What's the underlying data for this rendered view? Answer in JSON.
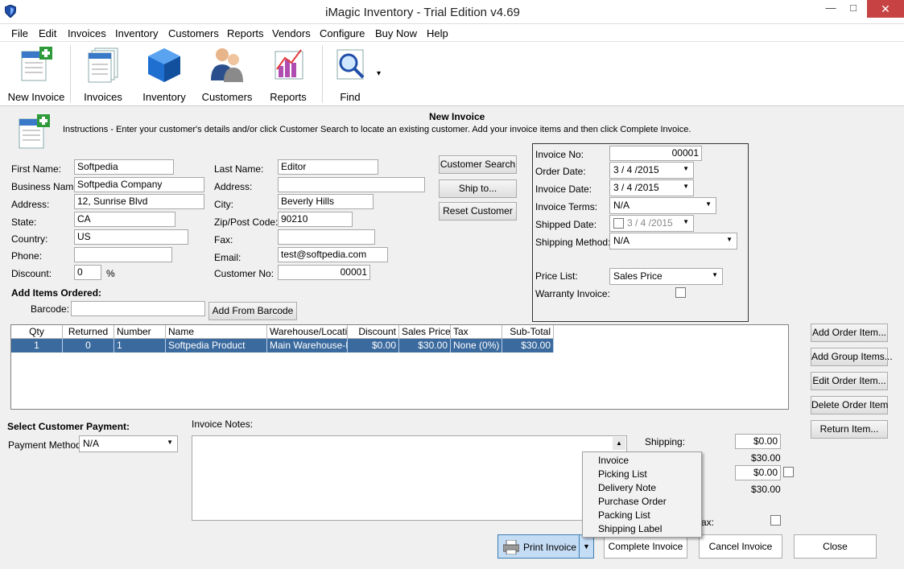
{
  "window": {
    "title": "iMagic Inventory - Trial Edition v4.69",
    "minimize": "—",
    "maximize": "□",
    "close": "✕"
  },
  "menu": [
    "File",
    "Edit",
    "Invoices",
    "Inventory",
    "Customers",
    "Reports",
    "Vendors",
    "Configure",
    "Buy Now",
    "Help"
  ],
  "toolbar": {
    "new_invoice": "New Invoice",
    "invoices": "Invoices",
    "inventory": "Inventory",
    "customers": "Customers",
    "reports": "Reports",
    "find": "Find",
    "find_dropdown": "▾"
  },
  "form": {
    "heading": "New Invoice",
    "instructions": "Instructions -  Enter your customer's details and/or click Customer Search to locate an existing customer. Add your invoice items and then click Complete Invoice.",
    "first_name_label": "First Name:",
    "first_name": "Softpedia",
    "business_name_label": "Business Name:",
    "business_name": "Softpedia Company",
    "address_label": "Address:",
    "address": "12, Sunrise Blvd",
    "state_label": "State:",
    "state": "CA",
    "country_label": "Country:",
    "country": "US",
    "phone_label": "Phone:",
    "phone": "",
    "discount_label": "Discount:",
    "discount": "0",
    "discount_unit": "%",
    "last_name_label": "Last Name:",
    "last_name": "Editor",
    "address2_label": "Address:",
    "address2": "",
    "city_label": "City:",
    "city": "Beverly Hills",
    "zip_label": "Zip/Post Code:",
    "zip": "90210",
    "fax_label": "Fax:",
    "fax": "",
    "email_label": "Email:",
    "email": "test@softpedia.com",
    "customer_no_label": "Customer No:",
    "customer_no": "00001",
    "customer_search": "Customer Search",
    "ship_to": "Ship to...",
    "reset_customer": "Reset Customer"
  },
  "invoice": {
    "invoice_no_label": "Invoice No:",
    "invoice_no": "00001",
    "order_date_label": "Order Date:",
    "order_date": "3 / 4 /2015",
    "invoice_date_label": "Invoice Date:",
    "invoice_date": "3 / 4 /2015",
    "terms_label": "Invoice Terms:",
    "terms": "N/A",
    "shipped_date_label": "Shipped Date:",
    "shipped_date": "3 / 4 /2015",
    "shipping_method_label": "Shipping Method:",
    "shipping_method": "N/A",
    "price_list_label": "Price List:",
    "price_list": "Sales Price",
    "warranty_label": "Warranty Invoice:"
  },
  "items": {
    "heading": "Add Items Ordered:",
    "barcode_label": "Barcode:",
    "barcode": "",
    "add_from_barcode": "Add From Barcode",
    "columns": [
      "Qty",
      "Returned",
      "Number",
      "Name",
      "Warehouse/Locatio",
      "Discount",
      "Sales Price",
      "Tax",
      "Sub-Total"
    ],
    "rows": [
      [
        "1",
        "0",
        "1",
        "Softpedia Product",
        "Main Warehouse-N.",
        "$0.00",
        "$30.00",
        "None (0%)",
        "$30.00"
      ]
    ]
  },
  "side_buttons": {
    "add_order_item": "Add Order Item...",
    "add_group_items": "Add Group Items...",
    "edit_order_item": "Edit Order Item...",
    "delete_order_item": "Delete Order Item",
    "return_item": "Return Item..."
  },
  "payment": {
    "heading": "Select Customer Payment:",
    "method_label": "Payment Method:",
    "method": "N/A",
    "notes_label": "Invoice Notes:"
  },
  "totals": {
    "shipping_label": "Shipping:",
    "shipping": "$0.00",
    "subtotal": "$30.00",
    "other": "$0.00",
    "total": "$30.00",
    "tax_label": "ax:"
  },
  "print_menu": [
    "Invoice",
    "Picking List",
    "Delivery Note",
    "Purchase Order",
    "Packing List",
    "Shipping Label"
  ],
  "bottom": {
    "print_invoice": "Print Invoice",
    "complete_invoice": "Complete Invoice",
    "cancel_invoice": "Cancel Invoice",
    "close": "Close"
  }
}
